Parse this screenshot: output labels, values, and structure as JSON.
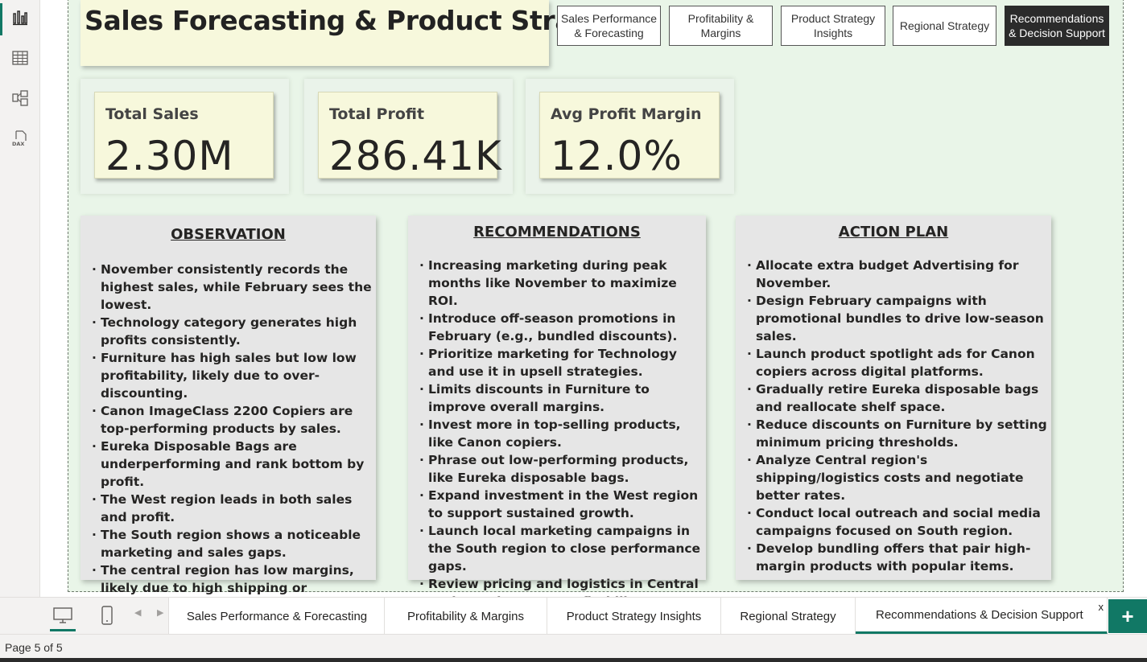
{
  "report": {
    "title": "Sales Forecasting & Product Strategy"
  },
  "nav_buttons": [
    {
      "label": "Sales Performance & Forecasting",
      "active": false
    },
    {
      "label": "Profitability & Margins",
      "active": false
    },
    {
      "label": "Product Strategy Insights",
      "active": false
    },
    {
      "label": "Regional Strategy",
      "active": false
    },
    {
      "label": "Recommendations & Decision Support",
      "active": true
    }
  ],
  "kpis": [
    {
      "label": "Total Sales",
      "value": "2.30M"
    },
    {
      "label": "Total Profit",
      "value": "286.41K"
    },
    {
      "label": "Avg Profit Margin",
      "value": "12.0%"
    }
  ],
  "observation": {
    "heading": "OBSERVATION ",
    "items": [
      "November consistently records the highest sales, while February sees the lowest.",
      "Technology category generates high profits consistently.",
      "Furniture has high sales but low low profitability, likely due to over-discounting.",
      "Canon ImageClass 2200 Copiers are top-performing products by sales.",
      "Eureka Disposable Bags are underperforming and rank bottom by profit.",
      "The West region leads in both sales and profit.",
      "The South region shows a noticeable marketing and sales gaps.",
      "The central region has low margins, likely due to high shipping or operational costs."
    ]
  },
  "recommendations": {
    "heading": "RECOMMENDATIONS",
    "items": [
      "Increasing marketing during peak months like November to maximize ROI.",
      "Introduce off-season promotions in February (e.g., bundled discounts).",
      "Prioritize marketing for Technology and use it in upsell strategies.",
      "Limits discounts in Furniture to improve overall margins.",
      "Invest more in top-selling products, like Canon copiers.",
      "Phrase out low-performing products, like Eureka disposable bags.",
      "Expand investment in the West region to support sustained growth.",
      "Launch local marketing campaigns in the South region to close  performance gaps.",
      "Review pricing and logistics in Central region to improve profitability."
    ]
  },
  "action_plan": {
    "heading": "ACTION PLAN",
    "items": [
      "Allocate extra budget Advertising for November.",
      "Design February campaigns with promotional bundles to drive low-season sales.",
      "Launch product spotlight ads for Canon copiers across digital platforms.",
      "Gradually retire Eureka disposable bags and reallocate shelf space.",
      "Reduce discounts on Furniture by setting minimum pricing thresholds.",
      "Analyze Central region's shipping/logistics costs and negotiate better rates.",
      "Conduct local outreach and social media campaigns focused on South region.",
      "Develop bundling offers that pair high-margin products with popular items."
    ]
  },
  "rail_icons": [
    "report-view-icon",
    "table-view-icon",
    "model-view-icon",
    "dax-query-icon"
  ],
  "page_tabs": [
    {
      "label": "Sales Performance & Forecasting",
      "active": false
    },
    {
      "label": "Profitability & Margins",
      "active": false
    },
    {
      "label": "Product Strategy Insights",
      "active": false
    },
    {
      "label": "Regional Strategy",
      "active": false
    },
    {
      "label": "Recommendations & Decision Support",
      "active": true
    }
  ],
  "tab_close_label": "x",
  "add_tab_label": "+",
  "status": {
    "page_indicator": "Page 5 of 5"
  },
  "colors": {
    "accent": "#117865",
    "page_background": "#e9f5e8",
    "card_yellow": "#f7f8dc",
    "text_card_gray": "#e6e6e6"
  }
}
